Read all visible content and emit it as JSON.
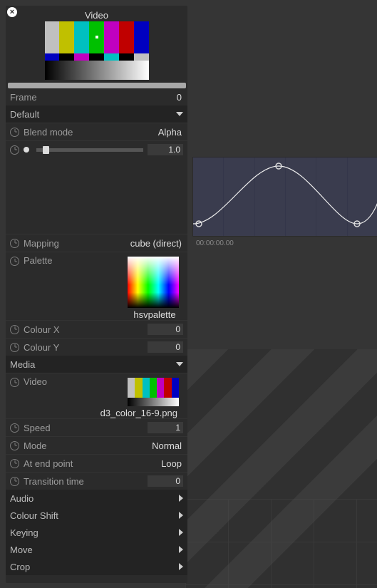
{
  "header": {
    "title": "Video"
  },
  "frame": {
    "label": "Frame",
    "value": "0"
  },
  "sections": {
    "default": {
      "label": "Default",
      "expanded": true
    },
    "media": {
      "label": "Media",
      "expanded": true
    },
    "audio": {
      "label": "Audio",
      "expanded": false
    },
    "colourshift": {
      "label": "Colour Shift",
      "expanded": false
    },
    "keying": {
      "label": "Keying",
      "expanded": false
    },
    "move": {
      "label": "Move",
      "expanded": false
    },
    "crop": {
      "label": "Crop",
      "expanded": false
    }
  },
  "default_props": {
    "blend": {
      "label": "Blend mode",
      "value": "Alpha"
    },
    "opacity": {
      "value": "1.0",
      "slider_pos": "6%"
    },
    "mapping": {
      "label": "Mapping",
      "value": "cube (direct)"
    },
    "palette": {
      "label": "Palette",
      "value": "hsvpalette"
    },
    "colourx": {
      "label": "Colour X",
      "value": "0"
    },
    "coloury": {
      "label": "Colour Y",
      "value": "0"
    }
  },
  "media": {
    "video": {
      "label": "Video",
      "value": "d3_color_16-9.png"
    },
    "speed": {
      "label": "Speed",
      "value": "1"
    },
    "mode": {
      "label": "Mode",
      "value": "Normal"
    },
    "endpt": {
      "label": "At end point",
      "value": "Loop"
    },
    "trans": {
      "label": "Transition time",
      "value": "0"
    }
  },
  "timeline": {
    "time_label": "00:00:00.00"
  },
  "smpte": {
    "top": [
      "#c0c0c0",
      "#c0c000",
      "#00c0c0",
      "#00c000",
      "#c000c0",
      "#c00000",
      "#0000c0"
    ],
    "mid": [
      "#0000c0",
      "#000000",
      "#c000c0",
      "#000000",
      "#00c0c0",
      "#000000",
      "#c0c0c0"
    ]
  }
}
